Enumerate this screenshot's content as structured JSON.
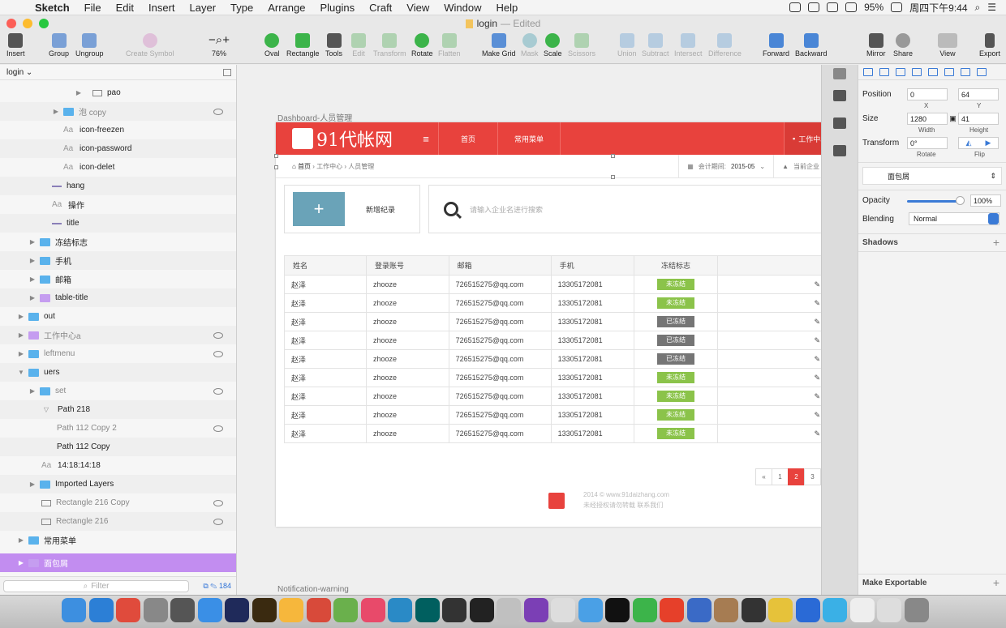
{
  "menubar": {
    "app": "Sketch",
    "items": [
      "File",
      "Edit",
      "Insert",
      "Layer",
      "Type",
      "Arrange",
      "Plugins",
      "Craft",
      "View",
      "Window",
      "Help"
    ],
    "battery": "95%",
    "clock": "周四下午9:44"
  },
  "window": {
    "file": "login",
    "status": "— Edited"
  },
  "toolbar": {
    "insert": "Insert",
    "group": "Group",
    "ungroup": "Ungroup",
    "create_symbol": "Create Symbol",
    "zoom": "76%",
    "oval": "Oval",
    "rectangle": "Rectangle",
    "tools": "Tools",
    "edit": "Edit",
    "transform": "Transform",
    "rotate": "Rotate",
    "flatten": "Flatten",
    "make_grid": "Make Grid",
    "mask": "Mask",
    "scale": "Scale",
    "scissors": "Scissors",
    "union": "Union",
    "subtract": "Subtract",
    "intersect": "Intersect",
    "difference": "Difference",
    "forward": "Forward",
    "backward": "Backward",
    "mirror": "Mirror",
    "share": "Share",
    "view": "View",
    "export": "Export"
  },
  "layers": {
    "page": "login ⌄",
    "items": [
      {
        "label": "pao",
        "kind": "shape"
      },
      {
        "label": "泡 copy",
        "kind": "folder"
      },
      {
        "label": "icon-freezen",
        "kind": "text"
      },
      {
        "label": "icon-password",
        "kind": "text"
      },
      {
        "label": "icon-delet",
        "kind": "text"
      },
      {
        "label": "hang",
        "kind": "line"
      },
      {
        "label": "操作",
        "kind": "text"
      },
      {
        "label": "title",
        "kind": "line"
      },
      {
        "label": "冻结标志",
        "kind": "folder"
      },
      {
        "label": "手机",
        "kind": "folder"
      },
      {
        "label": "邮箱",
        "kind": "folder"
      },
      {
        "label": "table-title",
        "kind": "folder"
      },
      {
        "label": "out",
        "kind": "folder"
      },
      {
        "label": "工作中心a",
        "kind": "folder"
      },
      {
        "label": "leftmenu",
        "kind": "folder"
      },
      {
        "label": "uers",
        "kind": "folder"
      },
      {
        "label": "set",
        "kind": "folder"
      },
      {
        "label": "Path 218",
        "kind": "path"
      },
      {
        "label": "Path 112 Copy 2",
        "kind": "path"
      },
      {
        "label": "Path 112 Copy",
        "kind": "path"
      },
      {
        "label": "14:18:14:18",
        "kind": "text"
      },
      {
        "label": "Imported Layers",
        "kind": "folder"
      },
      {
        "label": "Rectangle 216 Copy",
        "kind": "rect"
      },
      {
        "label": "Rectangle 216",
        "kind": "rect"
      },
      {
        "label": "常用菜单",
        "kind": "folder"
      },
      {
        "label": "面包屑",
        "kind": "folder"
      }
    ],
    "filter_placeholder": "Filter",
    "count": "184"
  },
  "canvas": {
    "artboard_label": "Dashboard-人员管理",
    "artboard2_label": "Notification-warning",
    "brand": "91代帐网",
    "nav": [
      "首页",
      "常用菜单"
    ],
    "work": "工作中心",
    "breadcrumb": [
      "首页",
      "工作中心",
      "人员管理"
    ],
    "period_label": "会计期间:",
    "period_value": "2015-05",
    "company": "当前企业",
    "add_label": "新增纪录",
    "search_placeholder": "请输入企业名进行搜索",
    "table_headers": [
      "姓名",
      "登录账号",
      "邮箱",
      "手机",
      "冻结标志",
      ""
    ],
    "rows": [
      {
        "name": "赵泽",
        "account": "zhooze",
        "email": "726515275@qq.com",
        "phone": "13305172081",
        "status": "未冻结"
      },
      {
        "name": "赵泽",
        "account": "zhooze",
        "email": "726515275@qq.com",
        "phone": "13305172081",
        "status": "未冻结"
      },
      {
        "name": "赵泽",
        "account": "zhooze",
        "email": "726515275@qq.com",
        "phone": "13305172081",
        "status": "已冻结"
      },
      {
        "name": "赵泽",
        "account": "zhooze",
        "email": "726515275@qq.com",
        "phone": "13305172081",
        "status": "已冻结"
      },
      {
        "name": "赵泽",
        "account": "zhooze",
        "email": "726515275@qq.com",
        "phone": "13305172081",
        "status": "已冻结"
      },
      {
        "name": "赵泽",
        "account": "zhooze",
        "email": "726515275@qq.com",
        "phone": "13305172081",
        "status": "未冻结"
      },
      {
        "name": "赵泽",
        "account": "zhooze",
        "email": "726515275@qq.com",
        "phone": "13305172081",
        "status": "未冻结"
      },
      {
        "name": "赵泽",
        "account": "zhooze",
        "email": "726515275@qq.com",
        "phone": "13305172081",
        "status": "未冻结"
      },
      {
        "name": "赵泽",
        "account": "zhooze",
        "email": "726515275@qq.com",
        "phone": "13305172081",
        "status": "未冻结"
      }
    ],
    "pager": [
      "«",
      "1",
      "2",
      "3"
    ],
    "footer_line1": "2014 © www.91daizhang.com",
    "footer_line2": "未经授权请勿转载 联系我们"
  },
  "inspector": {
    "position_label": "Position",
    "x": "0",
    "y": "64",
    "x_label": "X",
    "y_label": "Y",
    "size_label": "Size",
    "width": "1280",
    "height": "41",
    "width_label": "Width",
    "height_label": "Height",
    "transform_label": "Transform",
    "rotate": "0°",
    "rotate_label": "Rotate",
    "flip_label": "Flip",
    "style": "面包屑",
    "opacity_label": "Opacity",
    "opacity": "100%",
    "blending_label": "Blending",
    "blending": "Normal",
    "shadows": "Shadows",
    "make_exportable": "Make Exportable"
  },
  "colors": {
    "brand_red": "#e8423d",
    "unfrozen": "#8bc34a",
    "frozen": "#757575",
    "selection": "#c28df0"
  }
}
